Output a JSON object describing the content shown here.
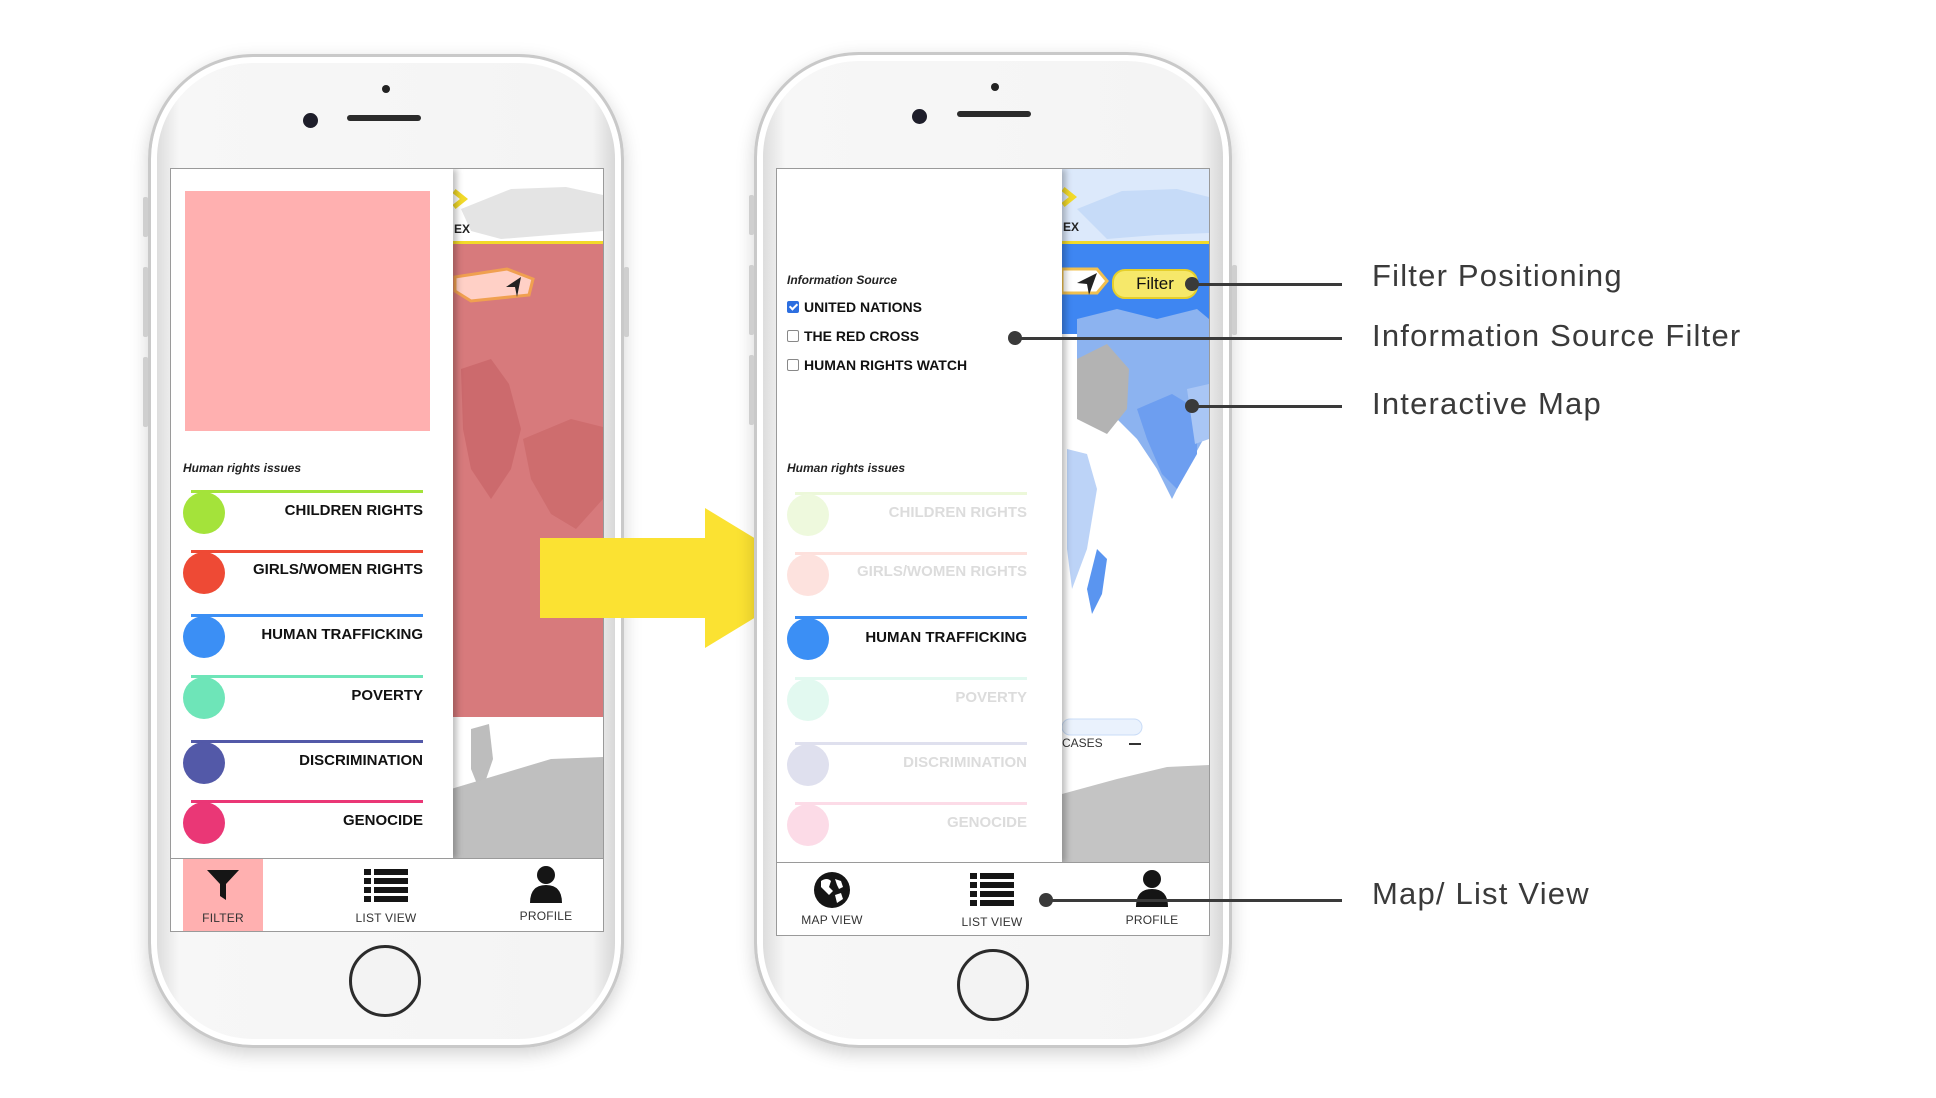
{
  "left_phone": {
    "map_header_fragment": "EX",
    "section_title": "Human rights issues",
    "issues": [
      {
        "label": "CHILDREN RIGHTS",
        "color": "#a4e33a"
      },
      {
        "label": "GIRLS/WOMEN RIGHTS",
        "color": "#ee4a35"
      },
      {
        "label": "HUMAN TRAFFICKING",
        "color": "#3b8ff5"
      },
      {
        "label": "POVERTY",
        "color": "#6ee5b8"
      },
      {
        "label": "DISCRIMINATION",
        "color": "#5359a8"
      },
      {
        "label": "GENOCIDE",
        "color": "#ea3776"
      }
    ],
    "tabs": [
      {
        "label": "FILTER",
        "icon": "funnel-icon",
        "active": true
      },
      {
        "label": "LIST VIEW",
        "icon": "list-icon",
        "active": false
      },
      {
        "label": "PROFILE",
        "icon": "person-icon",
        "active": false
      }
    ]
  },
  "right_phone": {
    "map_header_fragment": "EX",
    "filter_button": "Filter",
    "legend_fragment": "CASES",
    "info_source_title": "Information Source",
    "info_sources": [
      {
        "label": "UNITED NATIONS",
        "checked": true
      },
      {
        "label": "THE RED CROSS",
        "checked": false
      },
      {
        "label": "HUMAN RIGHTS WATCH",
        "checked": false
      }
    ],
    "section_title": "Human rights issues",
    "issues": [
      {
        "label": "CHILDREN RIGHTS",
        "active": false
      },
      {
        "label": "GIRLS/WOMEN RIGHTS",
        "active": false
      },
      {
        "label": "HUMAN TRAFFICKING",
        "active": true
      },
      {
        "label": "POVERTY",
        "active": false
      },
      {
        "label": "DISCRIMINATION",
        "active": false
      },
      {
        "label": "GENOCIDE",
        "active": false
      }
    ],
    "tabs": [
      {
        "label": "MAP VIEW",
        "icon": "globe-icon"
      },
      {
        "label": "LIST VIEW",
        "icon": "list-icon"
      },
      {
        "label": "PROFILE",
        "icon": "person-icon"
      }
    ]
  },
  "callouts": [
    {
      "label": "Filter Positioning"
    },
    {
      "label": "Information Source Filter"
    },
    {
      "label": "Interactive Map"
    },
    {
      "label": "Map/ List View"
    }
  ],
  "colors": {
    "highlight_pink": "#ffb0b0",
    "arrow_yellow": "#fbe232",
    "map_blue": "#3e86f2",
    "accent_yellow": "#f2da2a",
    "callout_gray": "#3a3a3a"
  }
}
